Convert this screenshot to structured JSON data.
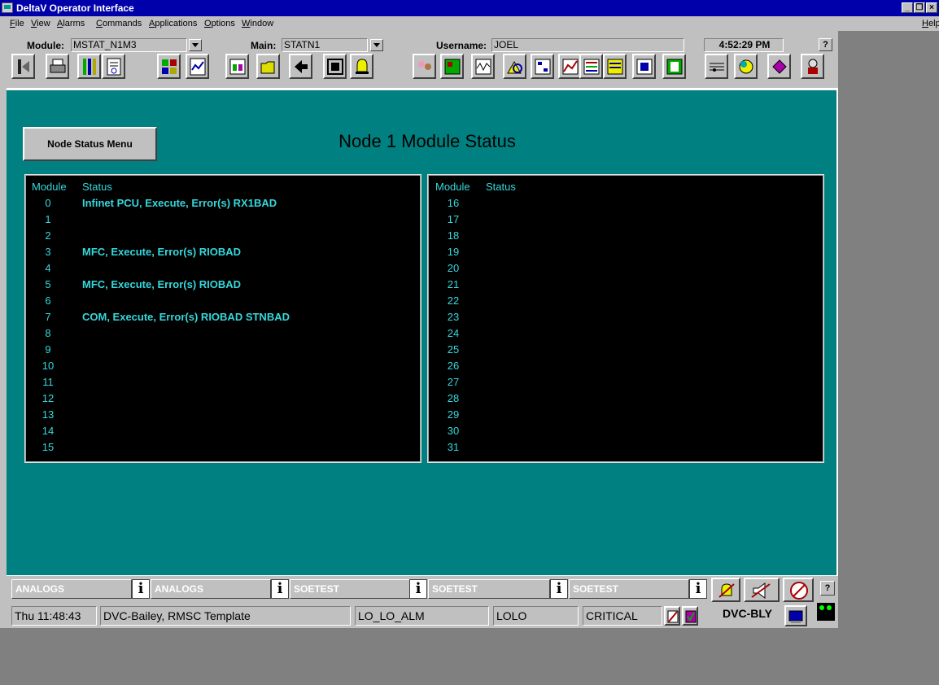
{
  "window": {
    "title": "DeltaV Operator Interface"
  },
  "menu": {
    "items": [
      "File",
      "View",
      "Alarms",
      "Commands",
      "Applications",
      "Options",
      "Window"
    ],
    "help": "Help"
  },
  "header": {
    "module_label": "Module:",
    "module_value": "MSTAT_N1M3",
    "main_label": "Main:",
    "main_value": "STATN1",
    "username_label": "Username:",
    "username_value": "JOEL",
    "time": "4:52:29 PM",
    "help_btn": "?"
  },
  "page": {
    "title": "Node 1 Module Status",
    "node_status_button": "Node Status Menu"
  },
  "left_table": {
    "col_module": "Module",
    "col_status": "Status",
    "rows": [
      {
        "module": "0",
        "status": "Infinet PCU, Execute, Error(s) RX1BAD"
      },
      {
        "module": "1",
        "status": ""
      },
      {
        "module": "2",
        "status": ""
      },
      {
        "module": "3",
        "status": "MFC, Execute, Error(s) RIOBAD"
      },
      {
        "module": "4",
        "status": ""
      },
      {
        "module": "5",
        "status": "MFC, Execute, Error(s) RIOBAD"
      },
      {
        "module": "6",
        "status": ""
      },
      {
        "module": "7",
        "status": "COM, Execute, Error(s) RIOBAD STNBAD"
      },
      {
        "module": "8",
        "status": ""
      },
      {
        "module": "9",
        "status": ""
      },
      {
        "module": "10",
        "status": ""
      },
      {
        "module": "11",
        "status": ""
      },
      {
        "module": "12",
        "status": ""
      },
      {
        "module": "13",
        "status": ""
      },
      {
        "module": "14",
        "status": ""
      },
      {
        "module": "15",
        "status": ""
      }
    ]
  },
  "right_table": {
    "col_module": "Module",
    "col_status": "Status",
    "rows": [
      {
        "module": "16",
        "status": ""
      },
      {
        "module": "17",
        "status": ""
      },
      {
        "module": "18",
        "status": ""
      },
      {
        "module": "19",
        "status": ""
      },
      {
        "module": "20",
        "status": ""
      },
      {
        "module": "21",
        "status": ""
      },
      {
        "module": "22",
        "status": ""
      },
      {
        "module": "23",
        "status": ""
      },
      {
        "module": "24",
        "status": ""
      },
      {
        "module": "25",
        "status": ""
      },
      {
        "module": "26",
        "status": ""
      },
      {
        "module": "27",
        "status": ""
      },
      {
        "module": "28",
        "status": ""
      },
      {
        "module": "29",
        "status": ""
      },
      {
        "module": "30",
        "status": ""
      },
      {
        "module": "31",
        "status": ""
      }
    ]
  },
  "alarm_bar": {
    "cells": [
      "ANALOGS",
      "ANALOGS",
      "SOETEST",
      "SOETEST",
      "SOETEST"
    ],
    "info_glyph": "i",
    "help_btn": "?"
  },
  "status_bar": {
    "datetime": "Thu 11:48:43",
    "description": "DVC-Bailey, RMSC Template",
    "alarm_name": "LO_LO_ALM",
    "alarm_type": "LOLO",
    "priority": "CRITICAL",
    "node_name": "DVC-BLY"
  },
  "colors": {
    "panel_bg": "#008080",
    "status_text": "#35d8dc",
    "title_bar": "#0000aa"
  }
}
